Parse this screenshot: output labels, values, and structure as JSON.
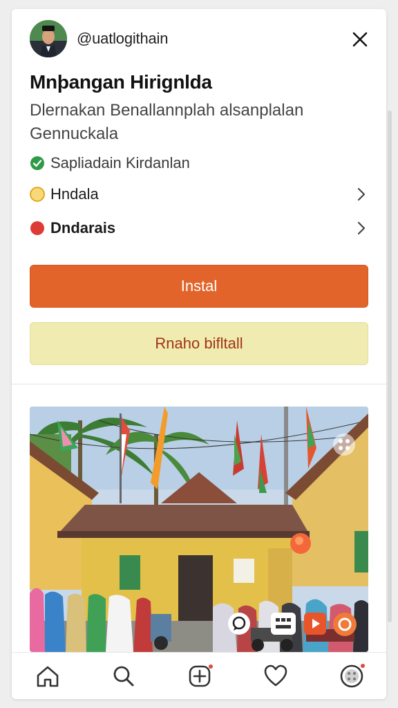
{
  "header": {
    "account_name": "@uatlogithain",
    "close_icon": "close-icon"
  },
  "app": {
    "title": "Mnþangan Hirignlda",
    "subtitle": "Dlernakan Benallannplah alsanplalan Gennuckala"
  },
  "details": {
    "verified_label": "Sapliadain Kirdanlan",
    "verified_icon": "check-circle-icon",
    "item1_label": "Hndala",
    "item1_icon": "yellow-dot-icon",
    "item2_label": "Dndarais",
    "item2_icon": "red-dot-icon"
  },
  "buttons": {
    "primary_label": "Instal",
    "secondary_label": "Rnaho bifltall"
  },
  "media": {
    "controls": [
      "comment-icon",
      "keyboard-icon",
      "play-icon",
      "record-icon"
    ],
    "corner_icon": "gallery-icon"
  },
  "bottom_nav": {
    "items": [
      "home-icon",
      "search-icon",
      "add-icon",
      "heart-icon",
      "profile-icon"
    ]
  },
  "colors": {
    "accent": "#e2642a",
    "secondary_bg": "#f0ebb0",
    "secondary_text": "#a03318",
    "verified": "#2e9b46",
    "warning": "#f1b81d",
    "danger": "#dd3b34"
  }
}
